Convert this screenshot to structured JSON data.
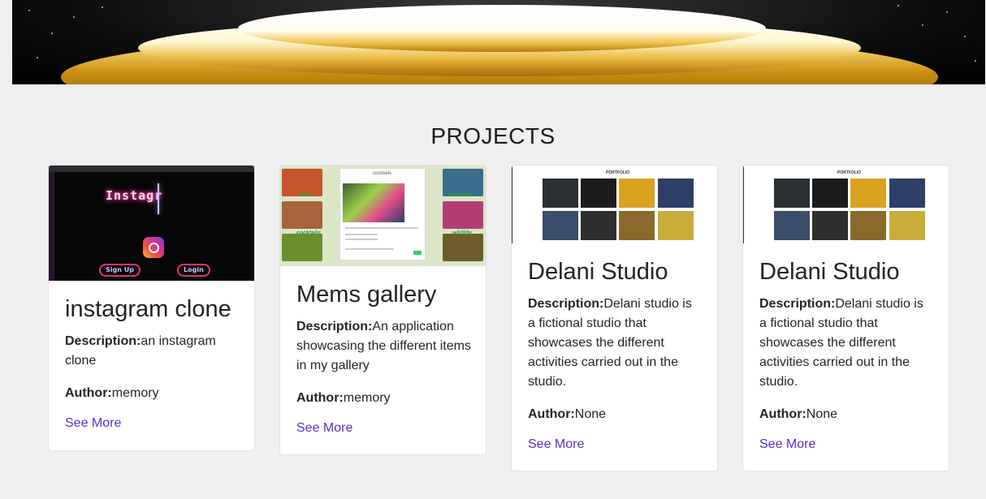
{
  "section_title": "PROJECTS",
  "projects": [
    {
      "title": "instagram clone",
      "description_label": "Description:",
      "description": "an instagram clone",
      "author_label": "Author:",
      "author": "memory",
      "link": "See More",
      "thumb": {
        "neon_text": "Instagr",
        "signup": "Sign Up",
        "login": "Login"
      }
    },
    {
      "title": "Mems gallery",
      "description_label": "Description:",
      "description": "An application showcasing the different items in my gallery",
      "author_label": "Author:",
      "author": "memory",
      "link": "See More",
      "thumb": {
        "label_food": "food",
        "label_cocktails": "cocktails",
        "label_cocktails2": "cocktails",
        "label_wildlife": "wildlife",
        "modal_title": "cocktails"
      }
    },
    {
      "title": "Delani Studio",
      "description_label": "Description:",
      "description": "Delani studio is a fictional studio that showcases the different activities carried out in the studio.",
      "author_label": "Author:",
      "author": "None",
      "link": "See More",
      "thumb": {
        "heading": "PORTFOLIO"
      }
    },
    {
      "title": "Delani Studio",
      "description_label": "Description:",
      "description": "Delani studio is a fictional studio that showcases the different activities carried out in the studio.",
      "author_label": "Author:",
      "author": "None",
      "link": "See More",
      "thumb": {
        "heading": "PORTFOLIO"
      }
    }
  ],
  "colors": {
    "link": "#5b2fc8",
    "background": "#efefef",
    "gold": "#e9b53b"
  }
}
